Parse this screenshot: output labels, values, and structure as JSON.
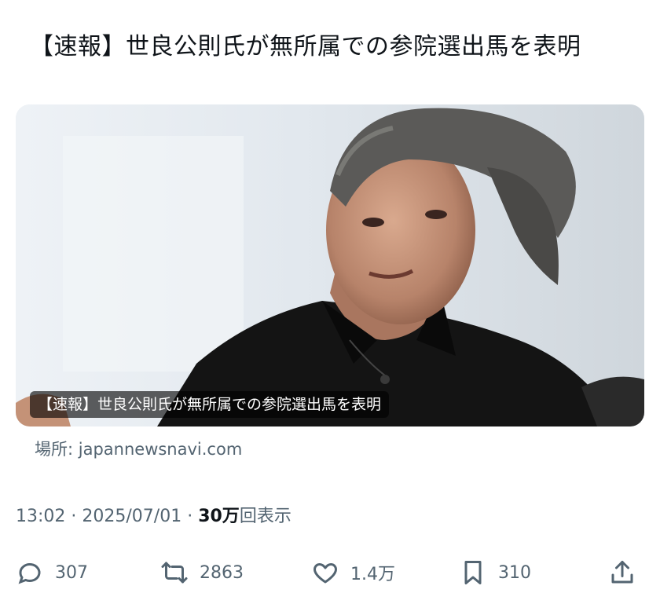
{
  "tweet": {
    "text": "【速報】世良公則氏が無所属での参院選出馬を表明"
  },
  "card": {
    "overlay_title": "【速報】世良公則氏が無所属での参院選出馬を表明",
    "source_label": "場所: japannewsnavi.com",
    "image": "photo of a middle-aged man with grey-streaked hair in a black shirt, speaking"
  },
  "meta": {
    "time": "13:02",
    "separator1": " · ",
    "date": "2025/07/01",
    "separator2": " · ",
    "views_count": "30万",
    "views_label": "回表示"
  },
  "actions": {
    "replies": {
      "icon": "reply-icon",
      "count": "307"
    },
    "reposts": {
      "icon": "repost-icon",
      "count": "2863"
    },
    "likes": {
      "icon": "like-icon",
      "count": "1.4万"
    },
    "bookmarks": {
      "icon": "bookmark-icon",
      "count": "310"
    },
    "share": {
      "icon": "share-icon"
    }
  },
  "colors": {
    "text_primary": "#0f1419",
    "text_secondary": "#536471",
    "background": "#ffffff"
  }
}
